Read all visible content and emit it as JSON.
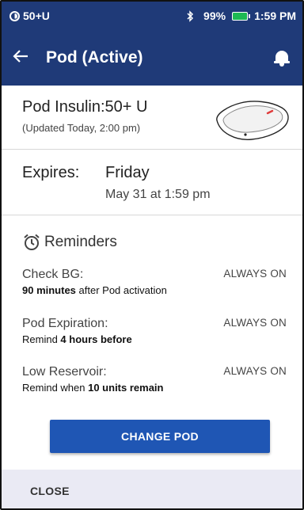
{
  "status_bar": {
    "pod_status": "50+U",
    "bluetooth_icon": "bluetooth-icon",
    "battery_percent": "99%",
    "time": "1:59 PM"
  },
  "app_bar": {
    "title": "Pod (Active)",
    "back_icon": "arrow-left-icon",
    "notification_icon": "bell-icon"
  },
  "insulin": {
    "title": "Pod Insulin:50+ U",
    "updated": "(Updated Today, 2:00 pm)"
  },
  "expires": {
    "label": "Expires:",
    "day": "Friday",
    "date": "May 31 at 1:59 pm"
  },
  "reminders": {
    "title": "Reminders",
    "items": [
      {
        "label": "Check BG:",
        "status": "ALWAYS ON",
        "desc_bold": "90 minutes",
        "desc_after": " after Pod activation",
        "desc_before": ""
      },
      {
        "label": "Pod Expiration:",
        "status": "ALWAYS ON",
        "desc_before": "Remind ",
        "desc_bold": "4 hours before",
        "desc_after": ""
      },
      {
        "label": "Low Reservoir:",
        "status": "ALWAYS ON",
        "desc_before": "Remind when ",
        "desc_bold": "10 units remain",
        "desc_after": ""
      }
    ]
  },
  "actions": {
    "change_pod": "CHANGE POD",
    "close": "CLOSE"
  },
  "colors": {
    "header_blue": "#1f3a78",
    "button_blue": "#1f56b4",
    "footer_bg": "#eaeaf4",
    "battery_green": "#1db954"
  }
}
